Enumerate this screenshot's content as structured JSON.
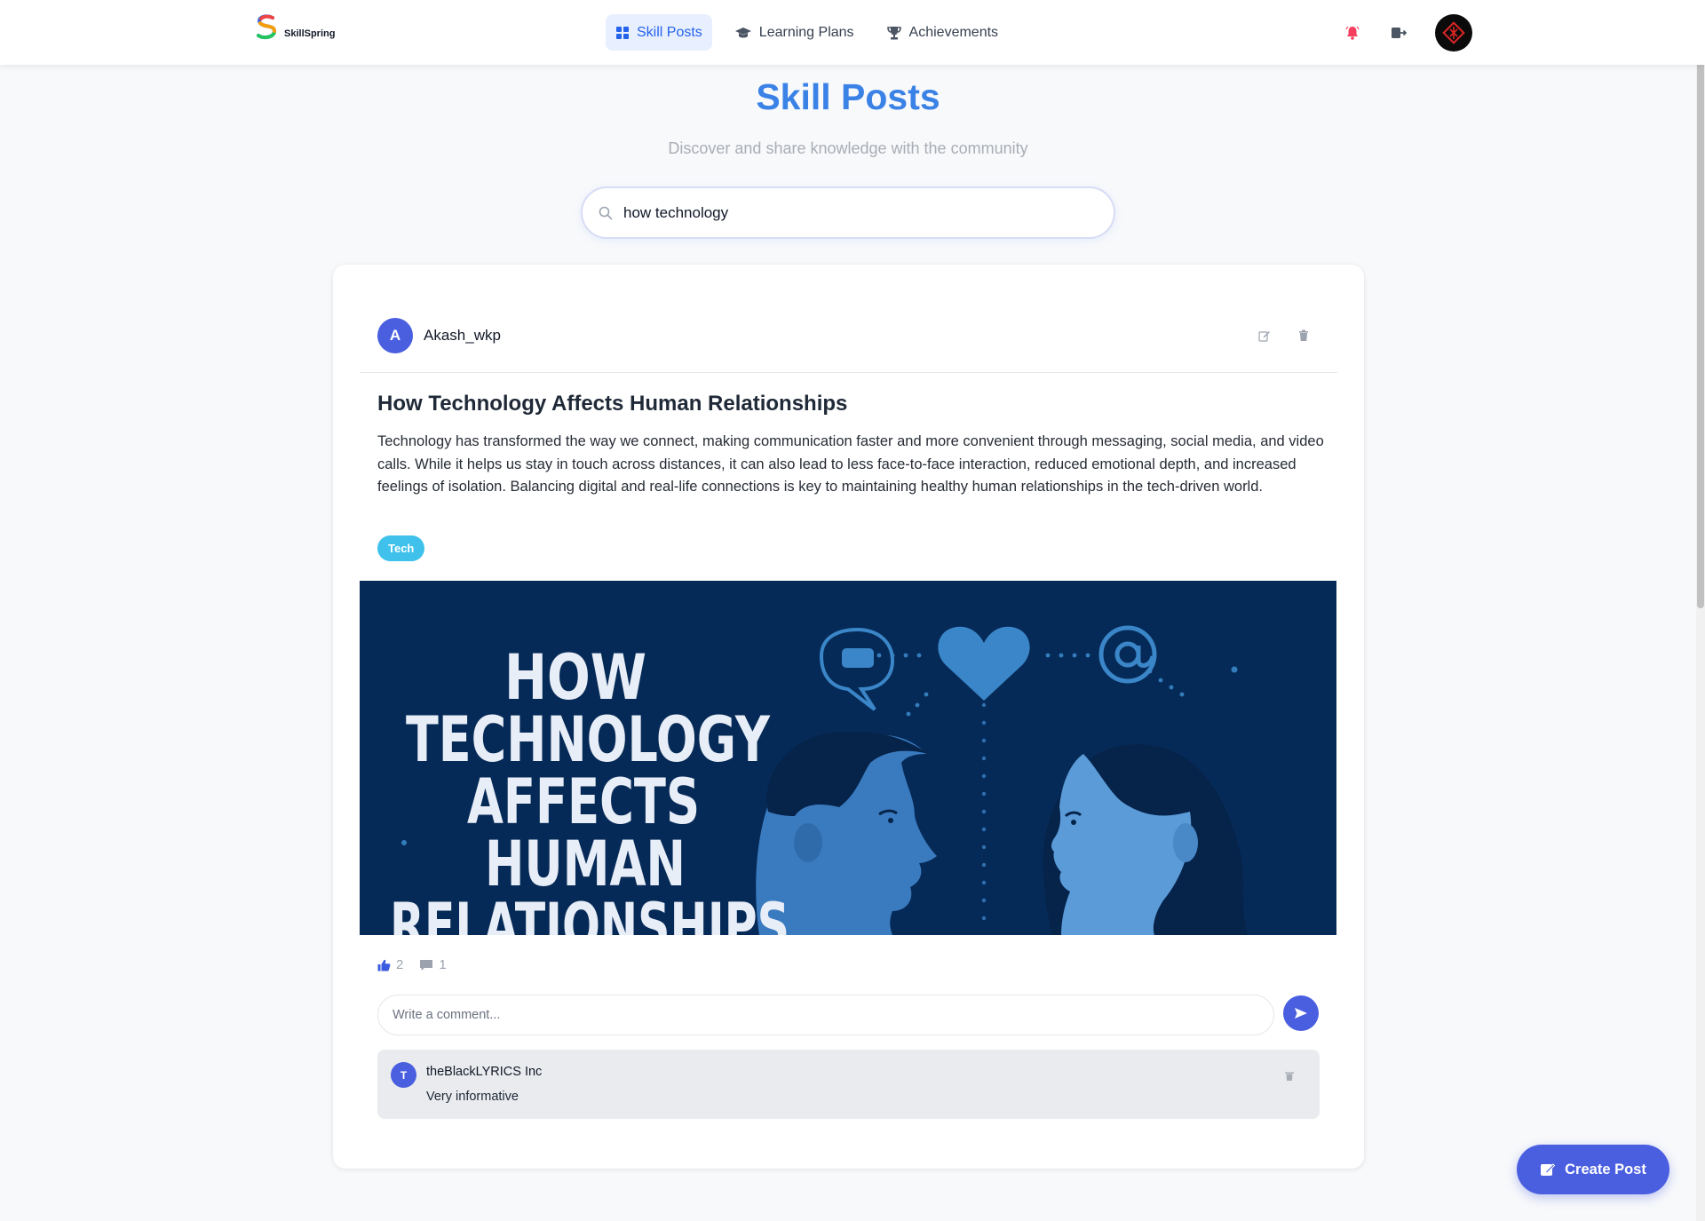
{
  "app": {
    "logo_text": "SkillSpring"
  },
  "nav": {
    "items": [
      {
        "label": "Skill Posts",
        "icon": "grid-icon",
        "active": true
      },
      {
        "label": "Learning Plans",
        "icon": "graduation-cap-icon",
        "active": false
      },
      {
        "label": "Achievements",
        "icon": "trophy-icon",
        "active": false
      }
    ]
  },
  "header_icons": [
    "bell-icon",
    "logout-icon",
    "avatar"
  ],
  "page": {
    "title": "Skill Posts",
    "subtitle": "Discover and share knowledge with the community"
  },
  "search": {
    "value": "how technology",
    "placeholder": ""
  },
  "post": {
    "author_initial": "A",
    "author": "Akash_wkp",
    "title": "How Technology Affects Human Relationships",
    "body": "Technology has transformed the way we connect, making communication faster and more convenient through messaging, social media, and video calls. While it helps us stay in touch across distances, it can also lead to less face-to-face interaction, reduced emotional depth, and increased feelings of isolation. Balancing digital and real-life connections is key to maintaining healthy human relationships in the tech-driven world.",
    "tag": "Tech",
    "image_caption": "HOW TECHNOLOGY AFFECTS HUMAN RELATIONSHIPS",
    "likes": "2",
    "comments_count": "1"
  },
  "comment_box": {
    "placeholder": "Write a comment..."
  },
  "comments": [
    {
      "initial": "T",
      "author": "theBlackLYRICS Inc",
      "text": "Very informative"
    }
  ],
  "fab": {
    "label": "Create Post"
  },
  "colors": {
    "accent": "#3b82e6",
    "primary": "#4a5fe0",
    "tag": "#3fc1ec",
    "notification": "#f43f5e",
    "image_bg": "#062a57"
  }
}
